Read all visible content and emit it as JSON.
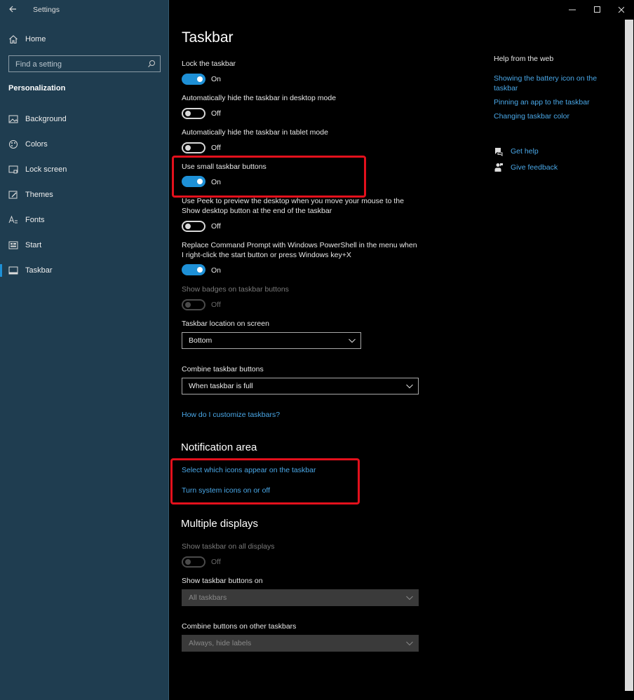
{
  "app": {
    "title": "Settings"
  },
  "sidebar": {
    "home_label": "Home",
    "search_placeholder": "Find a setting",
    "section_title": "Personalization",
    "items": [
      {
        "label": "Background",
        "icon": "picture-icon"
      },
      {
        "label": "Colors",
        "icon": "palette-icon"
      },
      {
        "label": "Lock screen",
        "icon": "lock-screen-icon"
      },
      {
        "label": "Themes",
        "icon": "brush-icon"
      },
      {
        "label": "Fonts",
        "icon": "font-icon"
      },
      {
        "label": "Start",
        "icon": "start-icon"
      },
      {
        "label": "Taskbar",
        "icon": "taskbar-icon",
        "active": true
      }
    ]
  },
  "main": {
    "title": "Taskbar",
    "settings": [
      {
        "label": "Lock the taskbar",
        "state": "On"
      },
      {
        "label": "Automatically hide the taskbar in desktop mode",
        "state": "Off"
      },
      {
        "label": "Automatically hide the taskbar in tablet mode",
        "state": "Off"
      },
      {
        "label": "Use small taskbar buttons",
        "state": "On"
      },
      {
        "label": "Use Peek to preview the desktop when you move your mouse to the Show desktop button at the end of the taskbar",
        "state": "Off"
      },
      {
        "label": "Replace Command Prompt with Windows PowerShell in the menu when I right-click the start button or press Windows key+X",
        "state": "On"
      },
      {
        "label": "Show badges on taskbar buttons",
        "state": "Off",
        "disabled": true
      }
    ],
    "location": {
      "label": "Taskbar location on screen",
      "value": "Bottom"
    },
    "combine": {
      "label": "Combine taskbar buttons",
      "value": "When taskbar is full"
    },
    "customize_link": "How do I customize taskbars?",
    "notification": {
      "heading": "Notification area",
      "link1": "Select which icons appear on the taskbar",
      "link2": "Turn system icons on or off"
    },
    "multiple": {
      "heading": "Multiple displays",
      "show_all_label": "Show taskbar on all displays",
      "show_all_state": "Off",
      "buttons_on_label": "Show taskbar buttons on",
      "buttons_on_value": "All taskbars",
      "combine_other_label": "Combine buttons on other taskbars",
      "combine_other_value": "Always, hide labels"
    }
  },
  "help": {
    "title": "Help from the web",
    "links": [
      "Showing the battery icon on the taskbar",
      "Pinning an app to the taskbar",
      "Changing taskbar color"
    ],
    "get_help": "Get help",
    "give_feedback": "Give feedback"
  },
  "colors": {
    "accent": "#1e90d6",
    "sidebar_bg": "#1f3d50",
    "link": "#4aa8e8",
    "highlight": "#e3101c"
  }
}
